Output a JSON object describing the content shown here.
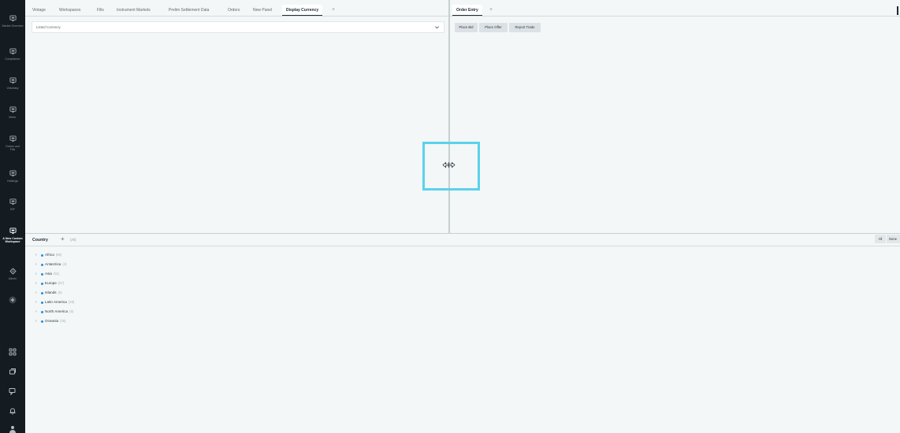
{
  "sidebar": {
    "items": [
      {
        "label": "Market Overview",
        "icon": "monitor-icon"
      },
      {
        "label": "Compliance",
        "icon": "monitor-icon"
      },
      {
        "label": "Voluntary",
        "icon": "monitor-icon"
      },
      {
        "label": "Meter",
        "icon": "monitor-icon"
      },
      {
        "label": "Orders and Fills",
        "icon": "monitor-icon"
      },
      {
        "label": "Holdings",
        "icon": "monitor-icon"
      },
      {
        "label": "EIP",
        "icon": "monitor-icon"
      },
      {
        "label": "A New Custom Workspace",
        "icon": "monitor-icon",
        "active": true
      },
      {
        "label": "Admin",
        "icon": "gear-icon"
      }
    ],
    "add_icon": "plus-circle-icon",
    "bottom_icons": [
      "grid-icon",
      "windows-icon",
      "chat-icon",
      "bell-icon",
      "user-icon"
    ]
  },
  "left_panel": {
    "tabs": [
      "Vintage",
      "Workspaces",
      "Fills",
      "Instrument Markets",
      "Prelim Settlement Data",
      "Orders",
      "New Panel",
      "Display Currency"
    ],
    "active_tab": "Display Currency",
    "add_tab": "+",
    "select": {
      "label": "Listed Currency"
    }
  },
  "right_panel": {
    "tab": "Order Entry",
    "add_tab": "+",
    "buttons": [
      "Place Bid",
      "Place Offer",
      "Report Trade"
    ]
  },
  "bottom_panel": {
    "tab": "Country",
    "add_tab": "+",
    "all_label": "(All)",
    "filter_buttons": {
      "all": "All",
      "none": "None"
    },
    "tree": [
      {
        "name": "Africa",
        "count": "(58)"
      },
      {
        "name": "Antarctica",
        "count": "(4)"
      },
      {
        "name": "Asia",
        "count": "(51)"
      },
      {
        "name": "Europe",
        "count": "(57)"
      },
      {
        "name": "Islands",
        "count": "(6)"
      },
      {
        "name": "Latin America",
        "count": "(49)"
      },
      {
        "name": "North America",
        "count": "(5)"
      },
      {
        "name": "Oceania",
        "count": "(26)"
      }
    ]
  },
  "colors": {
    "accent": "#5ad2ec",
    "sidebar": "#141c22",
    "dot": "#1e8fe6"
  }
}
